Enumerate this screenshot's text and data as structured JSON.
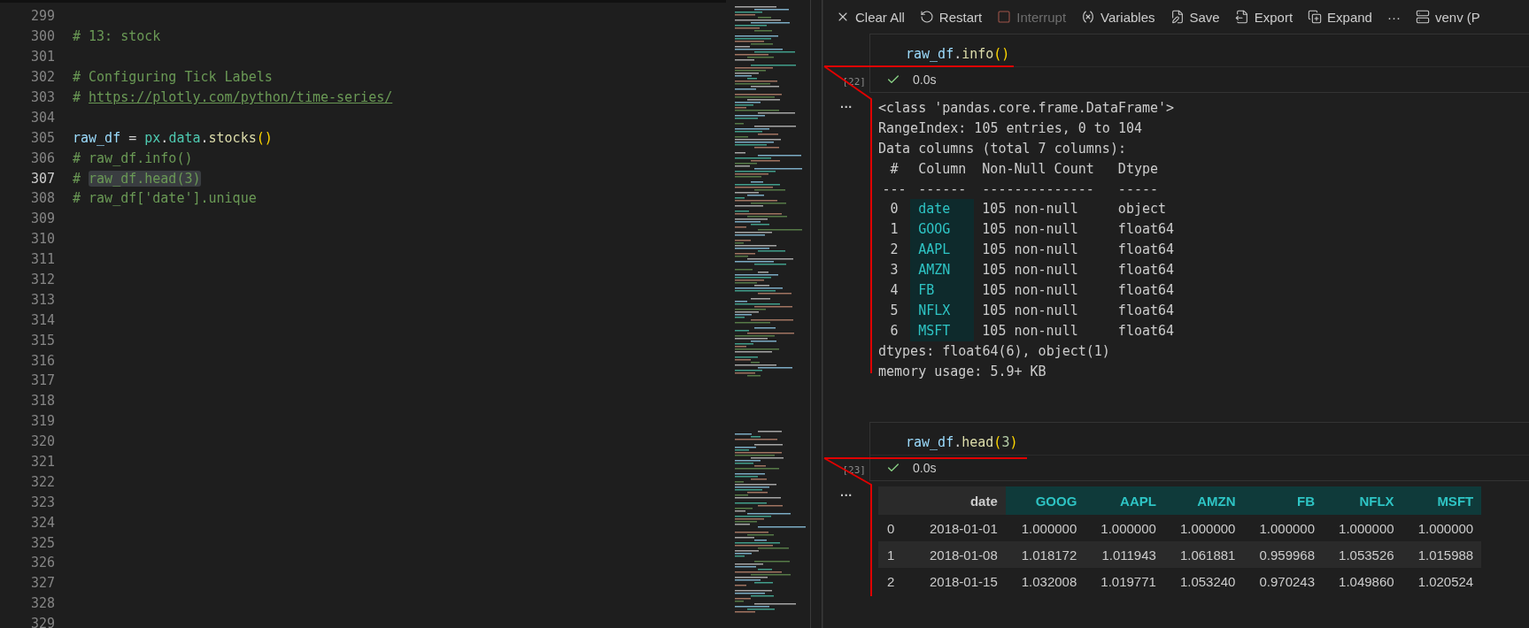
{
  "editor": {
    "lines": [
      {
        "number": "299",
        "current": false
      },
      {
        "number": "300",
        "current": false,
        "tokens": [
          {
            "kind": "comment",
            "text": "# 13: stock"
          }
        ]
      },
      {
        "number": "301",
        "current": false
      },
      {
        "number": "302",
        "current": false,
        "tokens": [
          {
            "kind": "comment",
            "text": "# Configuring Tick Labels"
          }
        ]
      },
      {
        "number": "303",
        "current": false,
        "tokens": [
          {
            "kind": "comment",
            "text": "# "
          },
          {
            "kind": "link",
            "text": "https://plotly.com/python/time-series/"
          }
        ]
      },
      {
        "number": "304",
        "current": false
      },
      {
        "number": "305",
        "current": false,
        "tokens": [
          {
            "kind": "variable",
            "text": "raw_df"
          },
          {
            "kind": "plain",
            "text": " = "
          },
          {
            "kind": "module",
            "text": "px"
          },
          {
            "kind": "plain",
            "text": "."
          },
          {
            "kind": "module",
            "text": "data"
          },
          {
            "kind": "plain",
            "text": "."
          },
          {
            "kind": "function",
            "text": "stocks"
          },
          {
            "kind": "paren",
            "text": "()"
          }
        ]
      },
      {
        "number": "306",
        "current": false,
        "tokens": [
          {
            "kind": "comment",
            "text": "# raw_df.info()"
          }
        ]
      },
      {
        "number": "307",
        "current": true,
        "tokens": [
          {
            "kind": "comment",
            "text": "# "
          },
          {
            "kind": "selected",
            "text": "raw_df.head(3)"
          }
        ]
      },
      {
        "number": "308",
        "current": false,
        "tokens": [
          {
            "kind": "comment",
            "text": "# raw_df['date'].unique"
          }
        ]
      },
      {
        "number": "309",
        "current": false
      },
      {
        "number": "310",
        "current": false
      },
      {
        "number": "311",
        "current": false
      },
      {
        "number": "312",
        "current": false
      },
      {
        "number": "313",
        "current": false
      },
      {
        "number": "314",
        "current": false
      },
      {
        "number": "315",
        "current": false
      },
      {
        "number": "316",
        "current": false
      },
      {
        "number": "317",
        "current": false
      },
      {
        "number": "318",
        "current": false
      },
      {
        "number": "319",
        "current": false
      },
      {
        "number": "320",
        "current": false
      },
      {
        "number": "321",
        "current": false
      },
      {
        "number": "322",
        "current": false
      },
      {
        "number": "323",
        "current": false
      },
      {
        "number": "324",
        "current": false
      },
      {
        "number": "325",
        "current": false
      },
      {
        "number": "326",
        "current": false
      },
      {
        "number": "327",
        "current": false
      },
      {
        "number": "328",
        "current": false
      },
      {
        "number": "329",
        "current": false
      }
    ]
  },
  "toolbar": [
    {
      "kind": "clear",
      "label": "Clear All",
      "disabled": false
    },
    {
      "kind": "restart",
      "label": "Restart",
      "disabled": false
    },
    {
      "kind": "interrupt",
      "label": "Interrupt",
      "disabled": true
    },
    {
      "kind": "variables",
      "label": "Variables",
      "disabled": false
    },
    {
      "kind": "save",
      "label": "Save",
      "disabled": false
    },
    {
      "kind": "export",
      "label": "Export",
      "disabled": false
    },
    {
      "kind": "expand",
      "label": "Expand",
      "disabled": false
    },
    {
      "kind": "more",
      "label": "···",
      "disabled": false
    },
    {
      "kind": "kernel",
      "label": "venv (P",
      "disabled": false
    }
  ],
  "cells": [
    {
      "count": "[22]",
      "status": "0.0s",
      "code": [
        {
          "kind": "variable",
          "text": "raw_df"
        },
        {
          "kind": "plain",
          "text": "."
        },
        {
          "kind": "function",
          "text": "info"
        },
        {
          "kind": "paren",
          "text": "()"
        }
      ],
      "output": {
        "kind": "text",
        "more": "···",
        "header_lines": [
          "<class 'pandas.core.frame.DataFrame'>",
          "RangeIndex: 105 entries, 0 to 104",
          "Data columns (total 7 columns):"
        ],
        "columns": [
          "#",
          "Column",
          "Non-Null Count",
          "Dtype"
        ],
        "rule": [
          "---",
          "------",
          "--------------",
          "-----"
        ],
        "rows": [
          {
            "index": "0",
            "column": "date",
            "count": "105 non-null",
            "dtype": "object"
          },
          {
            "index": "1",
            "column": "GOOG",
            "count": "105 non-null",
            "dtype": "float64"
          },
          {
            "index": "2",
            "column": "AAPL",
            "count": "105 non-null",
            "dtype": "float64"
          },
          {
            "index": "3",
            "column": "AMZN",
            "count": "105 non-null",
            "dtype": "float64"
          },
          {
            "index": "4",
            "column": "FB",
            "count": "105 non-null",
            "dtype": "float64"
          },
          {
            "index": "5",
            "column": "NFLX",
            "count": "105 non-null",
            "dtype": "float64"
          },
          {
            "index": "6",
            "column": "MSFT",
            "count": "105 non-null",
            "dtype": "float64"
          }
        ],
        "footer_lines": [
          "dtypes: float64(6), object(1)",
          "memory usage: 5.9+ KB"
        ]
      }
    },
    {
      "count": "[23]",
      "status": "0.0s",
      "code": [
        {
          "kind": "variable",
          "text": "raw_df"
        },
        {
          "kind": "plain",
          "text": "."
        },
        {
          "kind": "function",
          "text": "head"
        },
        {
          "kind": "paren",
          "text": "("
        },
        {
          "kind": "number",
          "text": "3"
        },
        {
          "kind": "paren",
          "text": ")"
        }
      ],
      "output": {
        "kind": "table",
        "more": "···",
        "columns": [
          "date",
          "GOOG",
          "AAPL",
          "AMZN",
          "FB",
          "NFLX",
          "MSFT"
        ],
        "rows": [
          {
            "index": "0",
            "cells": [
              "2018-01-01",
              "1.000000",
              "1.000000",
              "1.000000",
              "1.000000",
              "1.000000",
              "1.000000"
            ]
          },
          {
            "index": "1",
            "cells": [
              "2018-01-08",
              "1.018172",
              "1.011943",
              "1.061881",
              "0.959968",
              "1.053526",
              "1.015988"
            ]
          },
          {
            "index": "2",
            "cells": [
              "2018-01-15",
              "1.032008",
              "1.019771",
              "1.053240",
              "0.970243",
              "1.049860",
              "1.020524"
            ]
          }
        ]
      }
    }
  ]
}
